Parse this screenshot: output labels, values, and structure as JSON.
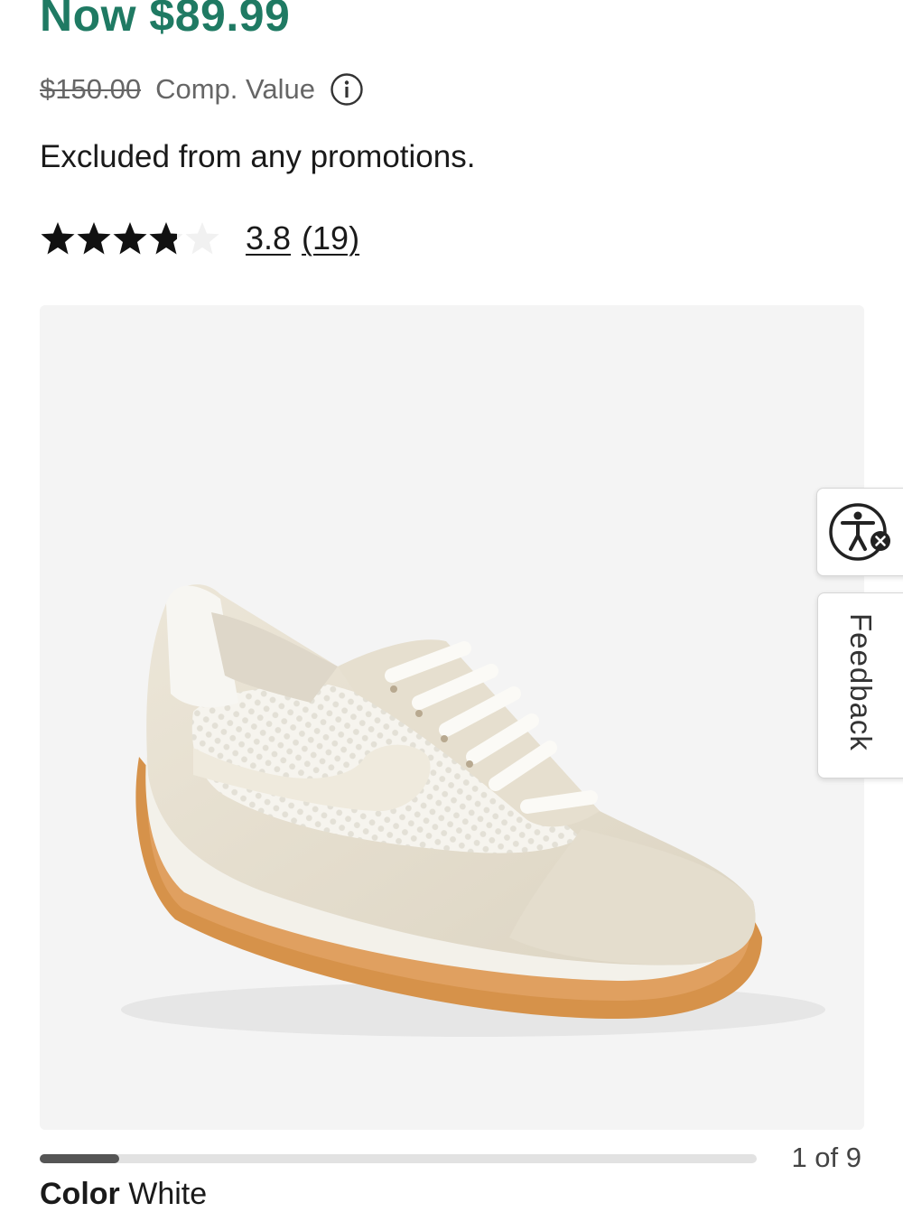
{
  "price": {
    "now_label": "Now $89.99",
    "comp_price": "$150.00",
    "comp_label": "Comp. Value",
    "color": "#1f7a63"
  },
  "promo_notice": "Excluded from any promotions.",
  "rating": {
    "value": 3.8,
    "value_label": "3.8",
    "count_label": "(19)",
    "max": 5,
    "star_icon": "star-icon"
  },
  "gallery": {
    "image_alt": "White mesh and suede sneaker with gum sole",
    "counter": "1 of 9",
    "current": 1,
    "total": 9
  },
  "side_tabs": {
    "accessibility_icon": "accessibility-icon",
    "feedback_label": "Feedback"
  },
  "color": {
    "label": "Color",
    "value": "White"
  }
}
